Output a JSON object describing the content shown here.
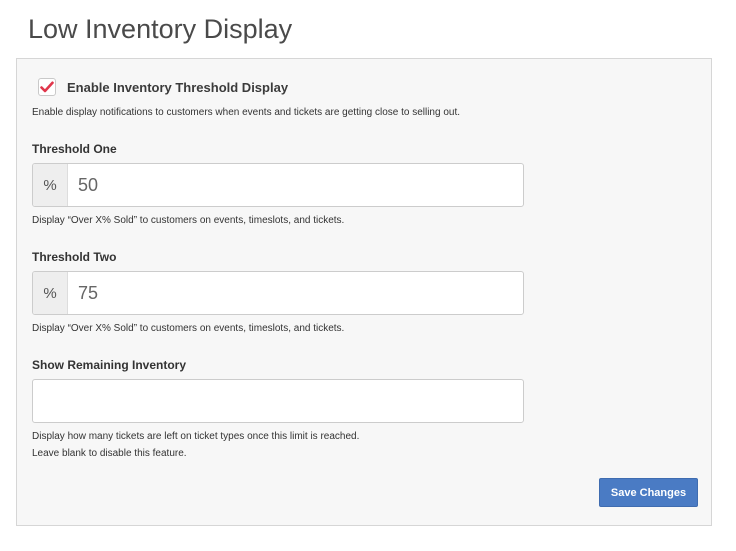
{
  "page": {
    "title": "Low Inventory Display"
  },
  "enable": {
    "checked": true,
    "label": "Enable Inventory Threshold Display",
    "help": "Enable display notifications to customers when events and tickets are getting close to selling out."
  },
  "threshold_one": {
    "label": "Threshold One",
    "addon": "%",
    "value": "50",
    "help": "Display “Over X% Sold” to customers on events, timeslots, and tickets."
  },
  "threshold_two": {
    "label": "Threshold Two",
    "addon": "%",
    "value": "75",
    "help": "Display “Over X% Sold” to customers on events, timeslots, and tickets."
  },
  "remaining": {
    "label": "Show Remaining Inventory",
    "value": "",
    "help_line1": "Display how many tickets are left on ticket types once this limit is reached.",
    "help_line2": "Leave blank to disable this feature."
  },
  "actions": {
    "save_label": "Save Changes"
  },
  "colors": {
    "check": "#e0364b",
    "primary_button": "#4a7bc4",
    "panel_bg": "#f7f7f7"
  },
  "icons": {
    "checkbox_mark": "checkmark-icon"
  }
}
